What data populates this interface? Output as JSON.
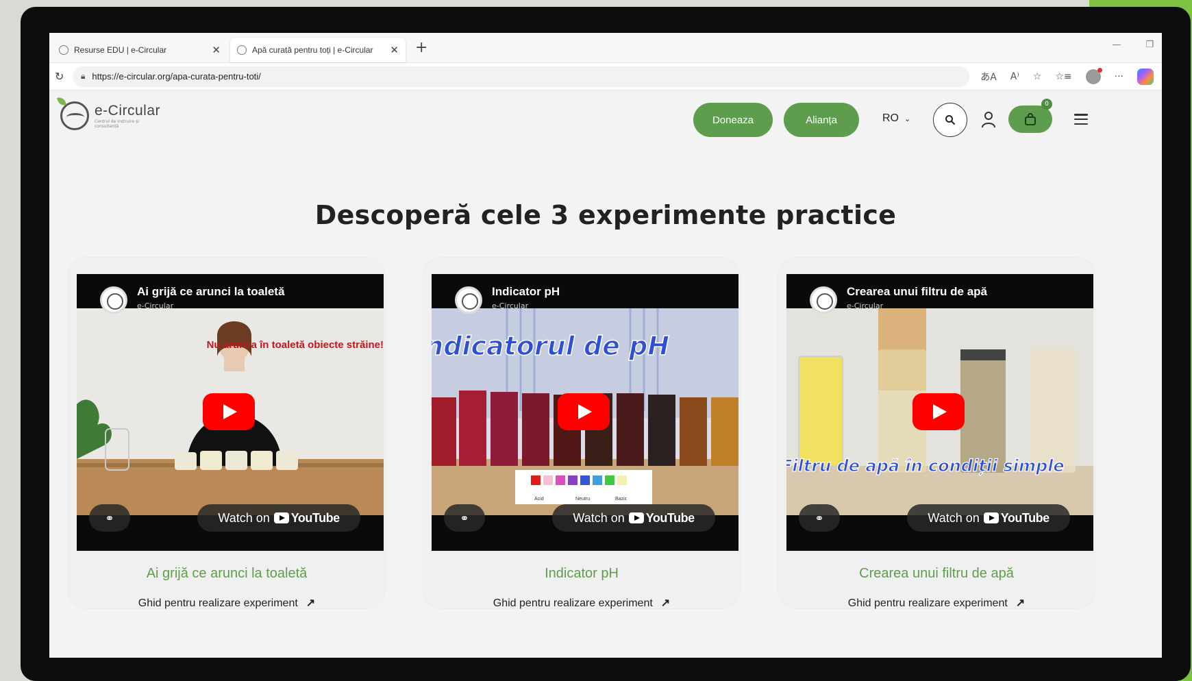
{
  "browser": {
    "tabs": [
      {
        "label": "Resurse EDU | e-Circular",
        "active": false
      },
      {
        "label": "Apă curată pentru toți | e-Circular",
        "active": true
      }
    ],
    "url": "https://e-circular.org/apa-curata-pentru-toti/"
  },
  "site": {
    "logo_name": "e-Circular",
    "logo_tagline": "Centrul de instruire și consultanță",
    "nav": {
      "donate": "Doneaza",
      "alliance": "Alianța",
      "language": "RO",
      "cart_count": "0"
    }
  },
  "main": {
    "headline": "Descoperă cele 3 experimente practice",
    "cards": [
      {
        "video_title": "Ai grijă ce arunci la toaletă",
        "channel": "e-Circular",
        "overlay_text": "Nu arunca în toaletă obiecte străine!",
        "title": "Ai grijă ce arunci la toaletă",
        "link": "Ghid pentru realizare experiment"
      },
      {
        "video_title": "Indicator pH",
        "channel": "e-Circular",
        "overlay_text": "Indicatorul de pH",
        "scale_labels": [
          "Acid",
          "Neutru",
          "Bazic"
        ],
        "title": "Indicator pH",
        "link": "Ghid pentru realizare experiment"
      },
      {
        "video_title": "Crearea unui filtru de apă",
        "channel": "e-Circular",
        "overlay_text": "Filtru de apă în condiții simple",
        "title": "Crearea unui filtru de apă",
        "link": "Ghid pentru realizare experiment"
      }
    ],
    "watch_on": "Watch on",
    "youtube": "YouTube"
  },
  "colors": {
    "brand_green": "#5e9d4e",
    "youtube_red": "#ff0000"
  }
}
